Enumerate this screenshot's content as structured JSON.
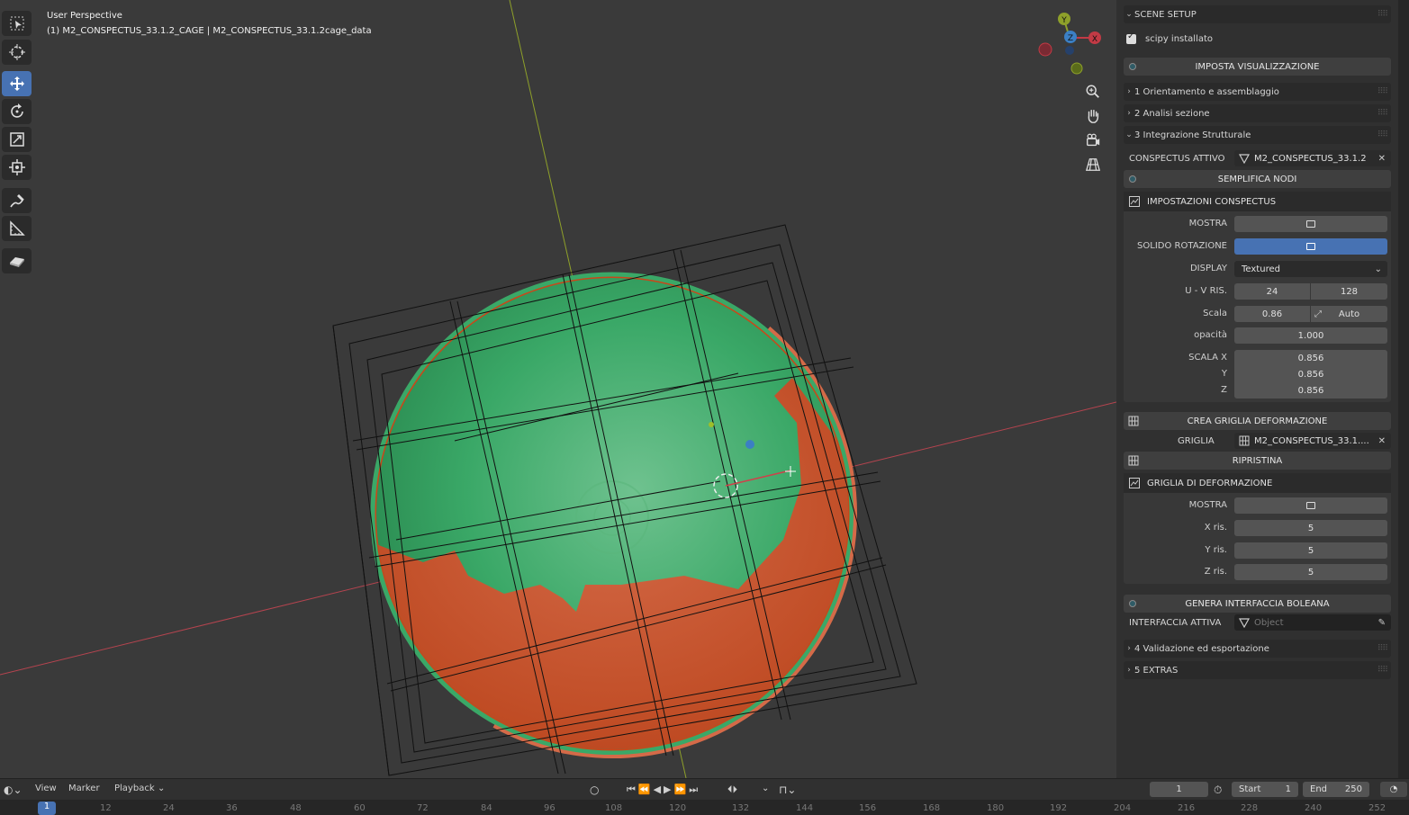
{
  "viewport": {
    "mode_label": "User Perspective",
    "object_label": "(1) M2_CONSPECTUS_33.1.2_CAGE | M2_CONSPECTUS_33.1.2cage_data",
    "gizmo": {
      "y_label": "Y",
      "z_label": "Z",
      "x_label": "X"
    },
    "colors": {
      "mesh_green": "#3aa867",
      "mesh_orange": "#c9471a",
      "x_axis": "#b5444f",
      "y_axis": "#8ea02a"
    }
  },
  "toolbar": {
    "tools": [
      "select-box-icon",
      "cursor-icon",
      "move-icon",
      "rotate-icon",
      "scale-icon",
      "transform-icon",
      "annotate-icon",
      "measure-icon",
      "add-cube-icon"
    ],
    "active": "move-icon"
  },
  "panel": {
    "scene_setup": "SCENE SETUP",
    "scipy_label": "scipy installato",
    "imposta_btn": "IMPOSTA VISUALIZZAZIONE",
    "sec1": "1 Orientamento e assemblaggio",
    "sec2": "2 Analisi sezione",
    "sec3": "3 Integrazione Strutturale",
    "conspectus_label": "CONSPECTUS ATTIVO",
    "conspectus_value": "M2_CONSPECTUS_33.1.2",
    "semplifica_btn": "SEMPLIFICA NODI",
    "impostazioni_hdr": "IMPOSTAZIONI CONSPECTUS",
    "mostra_label": "MOSTRA",
    "solido_label": "SOLIDO ROTAZIONE",
    "display_label": "DISPLAY",
    "display_value": "Textured",
    "uv_label": "U - V RIS.",
    "uv_u": "24",
    "uv_v": "128",
    "scala_label": "Scala",
    "scala_value": "0.86",
    "scala_auto": "Auto",
    "opacita_label": "opacità",
    "opacita_value": "1.000",
    "scalax_label": "SCALA X",
    "scalax_value": "0.856",
    "y_label": "Y",
    "y_value": "0.856",
    "z_label": "Z",
    "z_value": "0.856",
    "crea_btn": "CREA GRIGLIA DEFORMAZIONE",
    "griglia_label": "GRIGLIA",
    "griglia_value": "M2_CONSPECTUS_33.1....",
    "ripristina_btn": "RIPRISTINA",
    "griglia_def_hdr": "GRIGLIA DI DEFORMAZIONE",
    "mostra2_label": "MOSTRA",
    "xris_label": "X ris.",
    "xris_value": "5",
    "yris_label": "Y ris.",
    "yris_value": "5",
    "zris_label": "Z ris.",
    "zris_value": "5",
    "genera_btn": "GENERA INTERFACCIA BOLEANA",
    "interfaccia_label": "INTERFACCIA ATTIVA",
    "interfaccia_placeholder": "Object",
    "sec4": "4 Validazione ed esportazione",
    "sec5": "5 EXTRAS"
  },
  "timeline": {
    "menu_view": "View",
    "menu_marker": "Marker",
    "menu_playback": "Playback",
    "current_frame": "1",
    "start_label": "Start",
    "start_value": "1",
    "end_label": "End",
    "end_value": "250",
    "ticks": [
      "1",
      "12",
      "24",
      "36",
      "48",
      "60",
      "72",
      "84",
      "96",
      "108",
      "120",
      "132",
      "144",
      "156",
      "168",
      "180",
      "192",
      "204",
      "216",
      "228",
      "240",
      "252"
    ]
  }
}
